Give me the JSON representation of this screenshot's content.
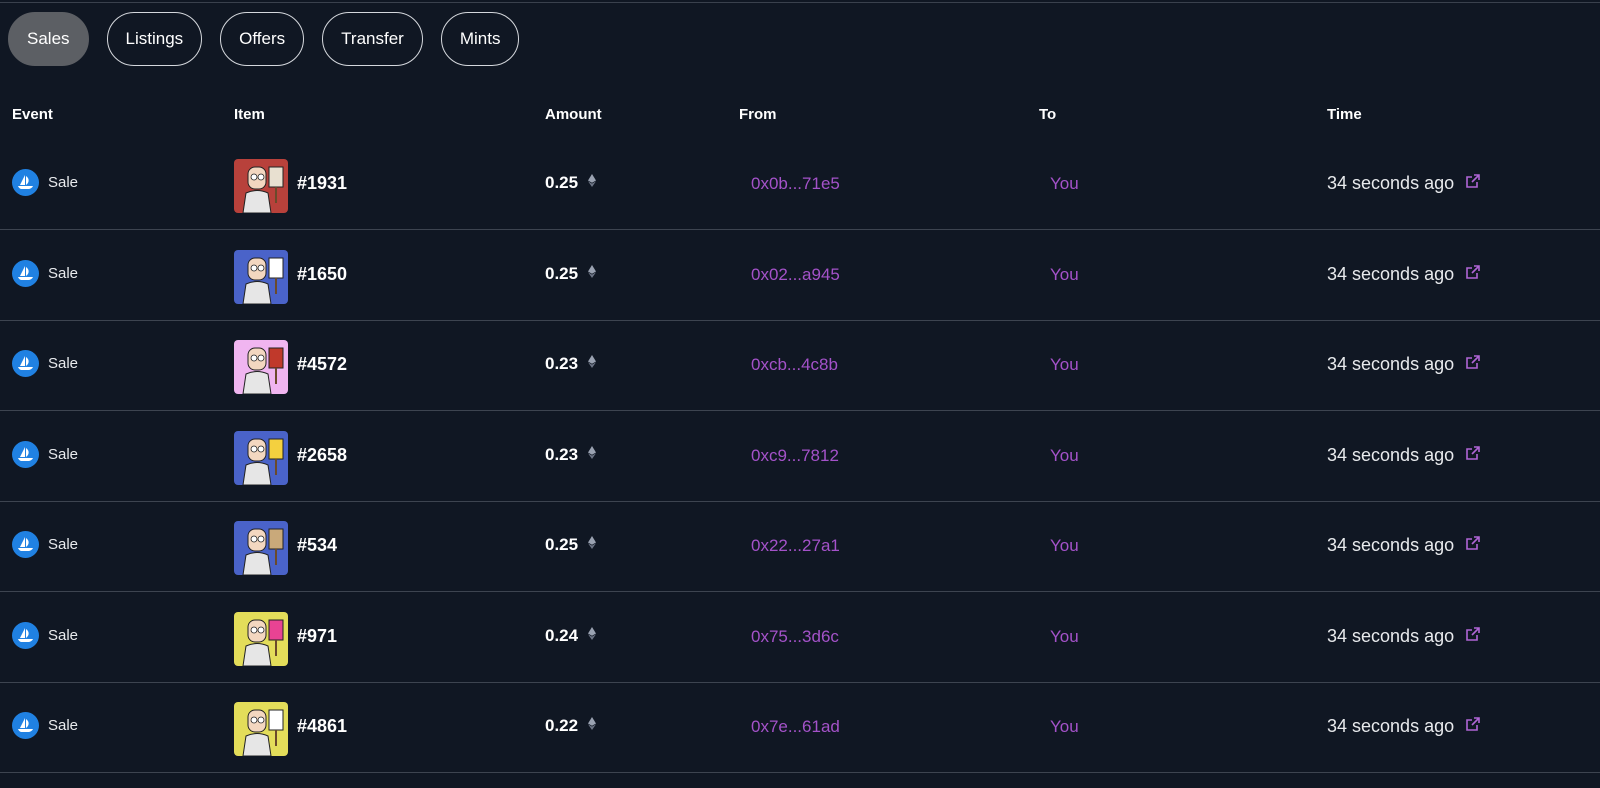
{
  "tabs": [
    {
      "label": "Sales",
      "active": true
    },
    {
      "label": "Listings",
      "active": false
    },
    {
      "label": "Offers",
      "active": false
    },
    {
      "label": "Transfer",
      "active": false
    },
    {
      "label": "Mints",
      "active": false
    }
  ],
  "headers": {
    "event": "Event",
    "item": "Item",
    "amount": "Amount",
    "from": "From",
    "to": "To",
    "time": "Time"
  },
  "colors": {
    "background": "#101723",
    "link": "#a452c9",
    "opensea_blue": "#2081e2",
    "active_tab": "#5c5f64"
  },
  "rows": [
    {
      "event": "Sale",
      "item": "#1931",
      "amount": "0.25",
      "from": "0x0b...71e5",
      "to": "You",
      "time": "34 seconds ago",
      "thumb_bg": "#b8413b",
      "thumb_accent": "#e8e0d0"
    },
    {
      "event": "Sale",
      "item": "#1650",
      "amount": "0.25",
      "from": "0x02...a945",
      "to": "You",
      "time": "34 seconds ago",
      "thumb_bg": "#4a63c9",
      "thumb_accent": "#ffffff"
    },
    {
      "event": "Sale",
      "item": "#4572",
      "amount": "0.23",
      "from": "0xcb...4c8b",
      "to": "You",
      "time": "34 seconds ago",
      "thumb_bg": "#f0b5f0",
      "thumb_accent": "#c0392b"
    },
    {
      "event": "Sale",
      "item": "#2658",
      "amount": "0.23",
      "from": "0xc9...7812",
      "to": "You",
      "time": "34 seconds ago",
      "thumb_bg": "#4a63c9",
      "thumb_accent": "#f4d03f"
    },
    {
      "event": "Sale",
      "item": "#534",
      "amount": "0.25",
      "from": "0x22...27a1",
      "to": "You",
      "time": "34 seconds ago",
      "thumb_bg": "#4a63c9",
      "thumb_accent": "#c9a97a"
    },
    {
      "event": "Sale",
      "item": "#971",
      "amount": "0.24",
      "from": "0x75...3d6c",
      "to": "You",
      "time": "34 seconds ago",
      "thumb_bg": "#e3dd5a",
      "thumb_accent": "#e84393"
    },
    {
      "event": "Sale",
      "item": "#4861",
      "amount": "0.22",
      "from": "0x7e...61ad",
      "to": "You",
      "time": "34 seconds ago",
      "thumb_bg": "#e3dd5a",
      "thumb_accent": "#ffffff"
    }
  ]
}
